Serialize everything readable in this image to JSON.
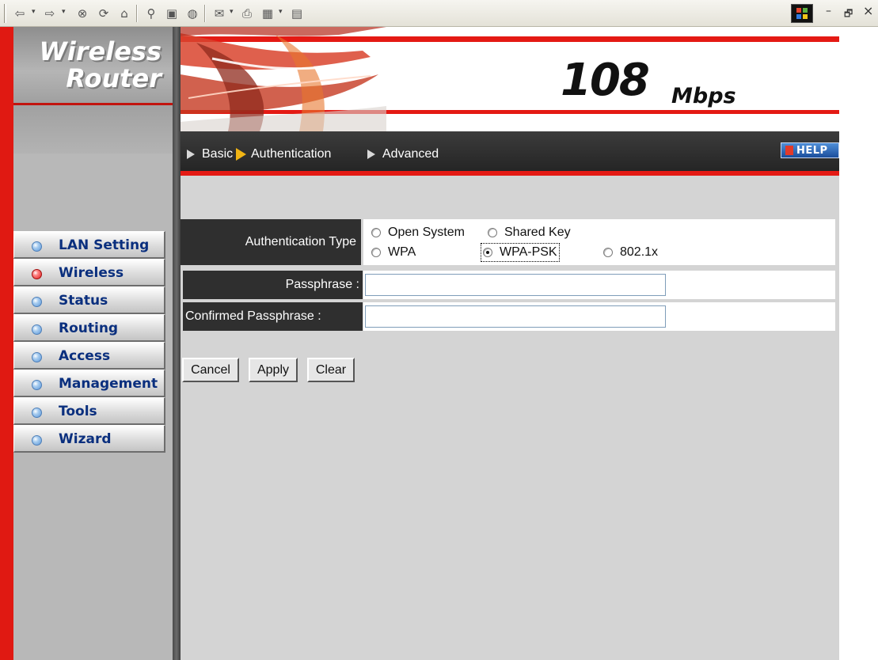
{
  "browser_toolbar": {
    "icons": [
      "back-icon",
      "forward-icon",
      "stop-icon",
      "refresh-icon",
      "home-icon",
      "search-icon",
      "favorites-icon",
      "history-icon",
      "mail-icon",
      "print-icon",
      "edit-icon",
      "discuss-icon",
      "windows-logo-icon",
      "minimize-icon",
      "restore-icon",
      "close-icon"
    ],
    "glyphs": {
      "back": "⇦",
      "forward": "⇨",
      "stop": "⊗",
      "refresh": "⟳",
      "home": "⌂",
      "search": "⚲",
      "favorites": "▣",
      "history": "◍",
      "mail": "✉",
      "print": "⎙",
      "edit": "▦",
      "discuss": "▤",
      "dropdown": "▾",
      "minimize": "–",
      "restore": "🗗",
      "close": "×"
    }
  },
  "brand": {
    "line1": "Wireless",
    "line2": "Router"
  },
  "banner": {
    "speed": "108",
    "unit": "Mbps"
  },
  "subnav": {
    "tabs": [
      {
        "label": "Basic",
        "active": false
      },
      {
        "label": "Authentication",
        "active": true
      },
      {
        "label": "Advanced",
        "active": false
      }
    ],
    "help_label": "HELP"
  },
  "sidebar": {
    "items": [
      {
        "label": "LAN Setting",
        "active": false
      },
      {
        "label": "Wireless",
        "active": true
      },
      {
        "label": "Status",
        "active": false
      },
      {
        "label": "Routing",
        "active": false
      },
      {
        "label": "Access",
        "active": false
      },
      {
        "label": "Management",
        "active": false
      },
      {
        "label": "Tools",
        "active": false
      },
      {
        "label": "Wizard",
        "active": false
      }
    ]
  },
  "form": {
    "auth_type_label": "Authentication Type",
    "auth_options": [
      {
        "label": "Open System",
        "checked": false
      },
      {
        "label": "Shared Key",
        "checked": false
      },
      {
        "label": "WPA",
        "checked": false
      },
      {
        "label": "WPA-PSK",
        "checked": true
      },
      {
        "label": "802.1x",
        "checked": false
      }
    ],
    "passphrase_label": "Passphrase :",
    "passphrase_value": "",
    "confirm_label": "Confirmed Passphrase :",
    "confirm_value": ""
  },
  "buttons": {
    "cancel": "Cancel",
    "apply": "Apply",
    "clear": "Clear"
  },
  "colors": {
    "accent_red": "#e01912",
    "nav_text": "#0a2f7e",
    "label_bg": "#2f2f2f",
    "content_bg": "#d4d4d4"
  }
}
